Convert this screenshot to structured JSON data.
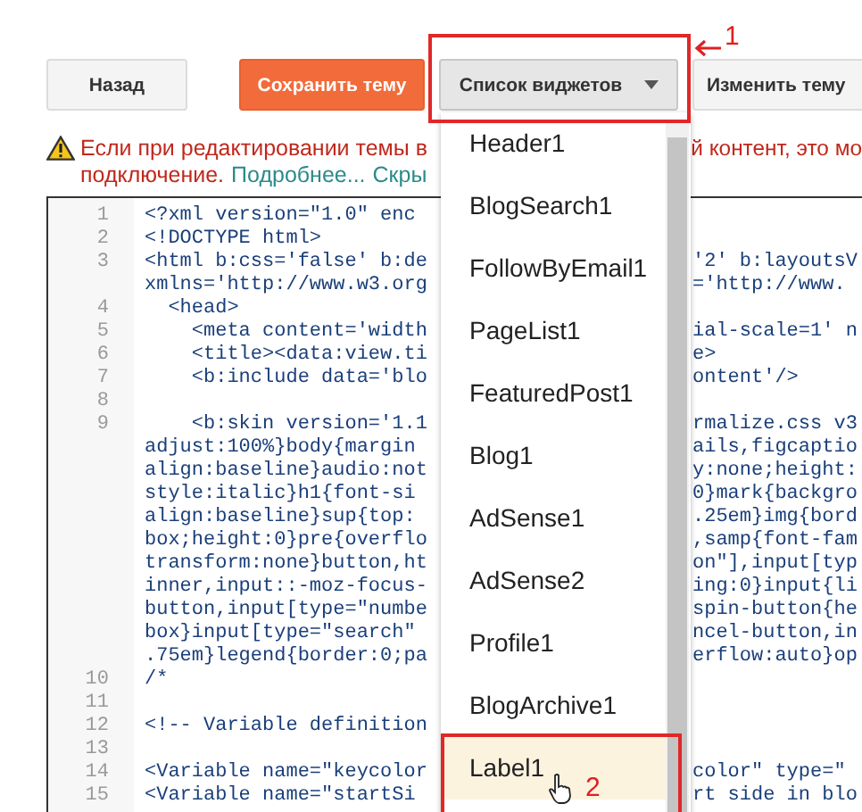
{
  "toolbar": {
    "buttons": [
      {
        "kind": "plain",
        "label": "Назад"
      },
      {
        "kind": "primary",
        "label": "Сохранить тему"
      },
      {
        "kind": "dropdown",
        "label": "Список виджетов",
        "expanded": true
      },
      {
        "kind": "plain",
        "label": "Изменить тему"
      }
    ]
  },
  "warning": {
    "line1_start": "Если при редактировании темы в",
    "line1_end": "й контент, это мо",
    "line2_text": "подключение.",
    "more_link": "Подробнее...",
    "hide_link": "Скры"
  },
  "editor": {
    "lines": [
      {
        "number": "1",
        "left": "<?xml version=\"1.0\" enc"
      },
      {
        "number": "2",
        "left": "<!DOCTYPE html>"
      },
      {
        "number": "3",
        "left": "<html b:css='false' b:de",
        "right": "'2' b:layoutsV"
      },
      {
        "left": "xmlns='http://www.w3.org",
        "right": "='http://www."
      },
      {
        "number": "4",
        "left": "  <head>"
      },
      {
        "number": "5",
        "left": "    <meta content='width",
        "right": "ial-scale=1' n"
      },
      {
        "number": "6",
        "left": "    <title><data:view.ti",
        "right": "e>"
      },
      {
        "number": "7",
        "left": "    <b:include data='blo",
        "right": "ontent'/>"
      },
      {
        "number": "8"
      },
      {
        "number": "9",
        "left": "    <b:skin version='1.1",
        "right": "rmalize.css v3"
      },
      {
        "left": "adjust:100%}body{margin",
        "right": "ails,figcaptio"
      },
      {
        "left": "align:baseline}audio:not",
        "right": "y:none;height:"
      },
      {
        "left": "style:italic}h1{font-si",
        "right": "0}mark{backgro"
      },
      {
        "left": "align:baseline}sup{top:",
        "right": ".25em}img{bord"
      },
      {
        "left": "box;height:0}pre{overflo",
        "right": ",samp{font-fam"
      },
      {
        "left": "transform:none}button,ht",
        "right": "on\"],input[typ"
      },
      {
        "left": "inner,input::-moz-focus-",
        "right": "ing:0}input{li"
      },
      {
        "left": "button,input[type=\"numbe",
        "right": "spin-button{he"
      },
      {
        "left": "box}input[type=\"search\"",
        "right": "ncel-button,in"
      },
      {
        "left": ".75em}legend{border:0;pa",
        "right": "erflow:auto}op"
      },
      {
        "number": "10",
        "left": "/*"
      },
      {
        "number": "11"
      },
      {
        "number": "12",
        "left": "<!-- Variable definition"
      },
      {
        "number": "13"
      },
      {
        "number": "14",
        "left": "<Variable name=\"keycolor",
        "right": "color\" type=\""
      },
      {
        "number": "15",
        "left": "<Variable name=\"startSi",
        "right": "rt side in blo"
      }
    ]
  },
  "widget_menu": {
    "items": [
      {
        "label": "Header1",
        "selected": false
      },
      {
        "label": "BlogSearch1",
        "selected": false
      },
      {
        "label": "FollowByEmail1",
        "selected": false
      },
      {
        "label": "PageList1",
        "selected": false
      },
      {
        "label": "FeaturedPost1",
        "selected": false
      },
      {
        "label": "Blog1",
        "selected": false
      },
      {
        "label": "AdSense1",
        "selected": false
      },
      {
        "label": "AdSense2",
        "selected": false
      },
      {
        "label": "Profile1",
        "selected": false
      },
      {
        "label": "BlogArchive1",
        "selected": false
      },
      {
        "label": "Label1",
        "selected": true
      }
    ]
  },
  "annotations": [
    {
      "kind": "arrow",
      "text": "1"
    },
    {
      "kind": "cursor",
      "text": "2"
    }
  ]
}
